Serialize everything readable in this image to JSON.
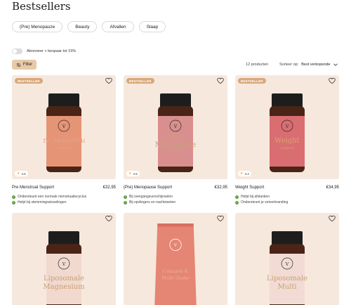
{
  "page": {
    "title": "Bestsellers"
  },
  "categories": [
    "(Pre) Menopauze",
    "Beauty",
    "Afvallen",
    "Slaap"
  ],
  "subscription": {
    "label": "Abonneer + bespaar tot 15%"
  },
  "toolbar": {
    "filter_label": "Filter",
    "count": "12 producten",
    "sort_label": "Sorteer op:",
    "sort_value": "Best verkopende"
  },
  "products": [
    {
      "badge": "BESTSELLER",
      "rating": "4.6",
      "name": "Pre Menstrual Support",
      "price": "€32,95",
      "benefits": [
        "Ondersteunt een normale menstruatiecyclus",
        "Helpt bij stemmingswisselingen"
      ],
      "label_text": [
        "Pre Menstrual",
        "support"
      ],
      "label_color": "#e2a383",
      "bg": "#f6e8dd",
      "label_bg": "#e69476"
    },
    {
      "badge": "BESTSELLER",
      "rating": "4.5",
      "name": "(Pre) Menopause Support",
      "price": "€32,95",
      "benefits": [
        "Bij overgangsverschijnselen",
        "Bij opvliegers en nachtzweten"
      ],
      "label_text": [
        "(Pre)",
        "Menopause",
        "support"
      ],
      "label_color": "#c8a07e",
      "bg": "#f6e8dd",
      "label_bg": "#d98f8d"
    },
    {
      "badge": "BESTSELLER",
      "rating": "4.4",
      "name": "Weight Support",
      "price": "€34,95",
      "benefits": [
        "Helpt bij afslanken",
        "Ondersteunt je vetverbranding"
      ],
      "label_text": [
        "Weight",
        "support"
      ],
      "label_color": "#d9a46b",
      "bg": "#f6e8dd",
      "label_bg": "#d96d72"
    },
    {
      "label_text": [
        "Liposomale",
        "Magnesium"
      ],
      "label_color": "#c9a072",
      "bg": "#f6e8dd",
      "label_bg": "#f1d9cf"
    },
    {
      "label_text": [
        "Collagen &",
        "Multi Shake"
      ],
      "label_color": "#e7b58a",
      "bg": "#f6e8dd",
      "label_bg": "#e58573"
    },
    {
      "label_text": [
        "Liposomale",
        "Multi"
      ],
      "label_color": "#c9a072",
      "bg": "#f6e8dd",
      "label_bg": "#f2dbd5"
    }
  ]
}
